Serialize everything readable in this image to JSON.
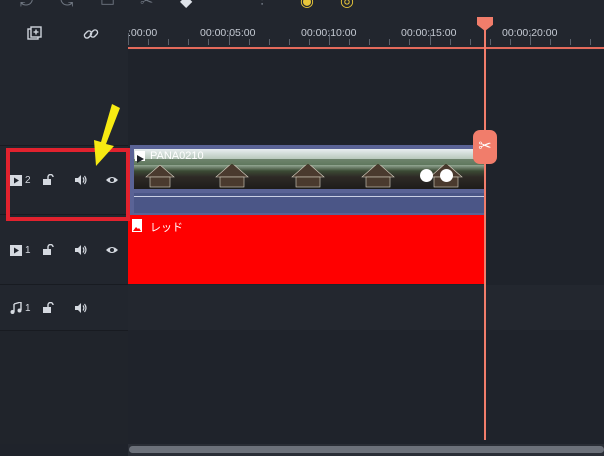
{
  "toolbar": {
    "icons": [
      "undo-icon",
      "redo-icon",
      "delete-icon",
      "cut-icon",
      "tag-icon",
      "audio-mixer-icon",
      "speed-icon",
      "timer-icon"
    ]
  },
  "header": {
    "icons": [
      "add-track-icon",
      "link-icon"
    ]
  },
  "ruler": {
    "labels": [
      ":00:00",
      "00:00:05:00",
      "00:00:10:00",
      "00:00:15:00",
      "00:00:20:00"
    ]
  },
  "tracks": [
    {
      "type": "video",
      "number": "2",
      "icons": [
        "video-track-icon",
        "lock-icon",
        "volume-icon",
        "eye-icon"
      ]
    },
    {
      "type": "video",
      "number": "1",
      "icons": [
        "video-track-icon",
        "lock-icon",
        "volume-icon",
        "eye-icon"
      ]
    },
    {
      "type": "audio",
      "number": "1",
      "icons": [
        "music-track-icon",
        "lock-icon",
        "volume-icon"
      ]
    }
  ],
  "clips": {
    "video_clip_label": "PANA0210",
    "color_clip_label": "レッド"
  },
  "colors": {
    "accent": "#f17d6b",
    "highlight_box": "#e2222e",
    "arrow": "#f7ea12",
    "color_clip": "#ff0000",
    "video_clip": "#5a6396"
  }
}
